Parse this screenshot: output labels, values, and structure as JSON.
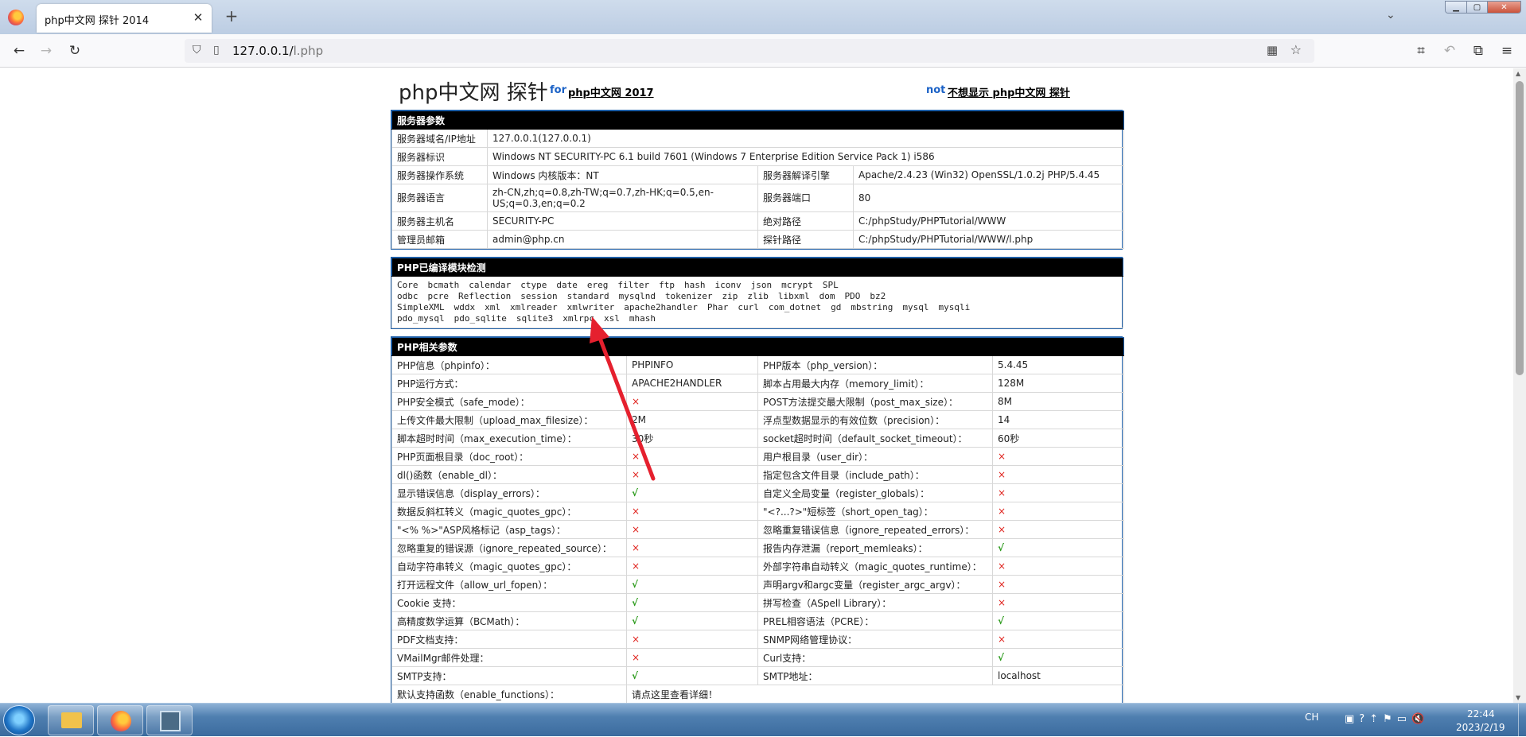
{
  "browser": {
    "tab_title": "php中文网 探针 2014",
    "tab_close": "✕",
    "new_tab": "+",
    "url_host": "127.0.0.1/",
    "url_path": "l.php"
  },
  "header": {
    "title": "php中文网 探针",
    "for_label": "for",
    "for_link": "php中文网 2017",
    "not_label": "not",
    "not_link": "不想显示 php中文网 探针"
  },
  "server": {
    "heading": "服务器参数",
    "rows": [
      {
        "k1": "服务器域名/IP地址",
        "v1": "127.0.0.1(127.0.0.1)"
      },
      {
        "k1": "服务器标识",
        "v1": "Windows NT SECURITY-PC 6.1 build 7601 (Windows 7 Enterprise Edition Service Pack 1) i586"
      },
      {
        "k1": "服务器操作系统",
        "v1": "Windows  内核版本：NT",
        "k2": "服务器解译引擎",
        "v2": "Apache/2.4.23 (Win32) OpenSSL/1.0.2j PHP/5.4.45"
      },
      {
        "k1": "服务器语言",
        "v1": "zh-CN,zh;q=0.8,zh-TW;q=0.7,zh-HK;q=0.5,en-US;q=0.3,en;q=0.2",
        "k2": "服务器端口",
        "v2": "80"
      },
      {
        "k1": "服务器主机名",
        "v1": "SECURITY-PC",
        "k2": "绝对路径",
        "v2": "C:/phpStudy/PHPTutorial/WWW"
      },
      {
        "k1": "管理员邮箱",
        "v1": "admin@php.cn",
        "k2": "探针路径",
        "v2": "C:/phpStudy/PHPTutorial/WWW/l.php"
      }
    ]
  },
  "modules": {
    "heading": "PHP已编译模块检测",
    "lines": [
      [
        "Core",
        "bcmath",
        "calendar",
        "ctype",
        "date",
        "ereg",
        "filter",
        "ftp",
        "hash",
        "iconv",
        "json",
        "mcrypt",
        "SPL"
      ],
      [
        "odbc",
        "pcre",
        "Reflection",
        "session",
        "standard",
        "mysqlnd",
        "tokenizer",
        "zip",
        "zlib",
        "libxml",
        "dom",
        "PDO",
        "bz2"
      ],
      [
        "SimpleXML",
        "wddx",
        "xml",
        "xmlreader",
        "xmlwriter",
        "apache2handler",
        "Phar",
        "curl",
        "com_dotnet",
        "gd",
        "mbstring",
        "mysql",
        "mysqli"
      ],
      [
        "pdo_mysql",
        "pdo_sqlite",
        "sqlite3",
        "xmlrpc",
        "xsl",
        "mhash"
      ]
    ]
  },
  "php": {
    "heading": "PHP相关参数",
    "rows": [
      {
        "k1": "PHP信息（phpinfo）：",
        "v1": "PHPINFO",
        "k2": "PHP版本（php_version）：",
        "v2": "5.4.45"
      },
      {
        "k1": "PHP运行方式：",
        "v1": "APACHE2HANDLER",
        "k2": "脚本占用最大内存（memory_limit）：",
        "v2": "128M"
      },
      {
        "k1": "PHP安全模式（safe_mode）：",
        "v1": "×",
        "k2": "POST方法提交最大限制（post_max_size）：",
        "v2": "8M"
      },
      {
        "k1": "上传文件最大限制（upload_max_filesize）：",
        "v1": "2M",
        "k2": "浮点型数据显示的有效位数（precision）：",
        "v2": "14"
      },
      {
        "k1": "脚本超时时间（max_execution_time）：",
        "v1": "30秒",
        "k2": "socket超时时间（default_socket_timeout）：",
        "v2": "60秒"
      },
      {
        "k1": "PHP页面根目录（doc_root）：",
        "v1": "×",
        "k2": "用户根目录（user_dir）：",
        "v2": "×"
      },
      {
        "k1": "dl()函数（enable_dl）：",
        "v1": "×",
        "k2": "指定包含文件目录（include_path）：",
        "v2": "×"
      },
      {
        "k1": "显示错误信息（display_errors）：",
        "v1": "√",
        "k2": "自定义全局变量（register_globals）：",
        "v2": "×"
      },
      {
        "k1": "数据反斜杠转义（magic_quotes_gpc）：",
        "v1": "×",
        "k2": "\"<?...?>\"短标签（short_open_tag）：",
        "v2": "×"
      },
      {
        "k1": "\"<% %>\"ASP风格标记（asp_tags）：",
        "v1": "×",
        "k2": "忽略重复错误信息（ignore_repeated_errors）：",
        "v2": "×"
      },
      {
        "k1": "忽略重复的错误源（ignore_repeated_source）：",
        "v1": "×",
        "k2": "报告内存泄漏（report_memleaks）：",
        "v2": "√"
      },
      {
        "k1": "自动字符串转义（magic_quotes_gpc）：",
        "v1": "×",
        "k2": "外部字符串自动转义（magic_quotes_runtime）：",
        "v2": "×"
      },
      {
        "k1": "打开远程文件（allow_url_fopen）：",
        "v1": "√",
        "k2": "声明argv和argc变量（register_argc_argv）：",
        "v2": "×"
      },
      {
        "k1": "Cookie 支持：",
        "v1": "√",
        "k2": "拼写检查（ASpell Library）：",
        "v2": "×"
      },
      {
        "k1": "高精度数学运算（BCMath）：",
        "v1": "√",
        "k2": "PREL相容语法（PCRE）：",
        "v2": "√"
      },
      {
        "k1": "PDF文档支持：",
        "v1": "×",
        "k2": "SNMP网络管理协议：",
        "v2": "×"
      },
      {
        "k1": "VMailMgr邮件处理：",
        "v1": "×",
        "k2": "Curl支持：",
        "v2": "√"
      },
      {
        "k1": "SMTP支持：",
        "v1": "√",
        "k2": "SMTP地址：",
        "v2": "localhost"
      }
    ],
    "functions_label": "默认支持函数（enable_functions）：",
    "functions_link": "请点这里查看详细！"
  },
  "taskbar": {
    "lang": "CH",
    "time": "22:44",
    "date": "2023/2/19"
  }
}
